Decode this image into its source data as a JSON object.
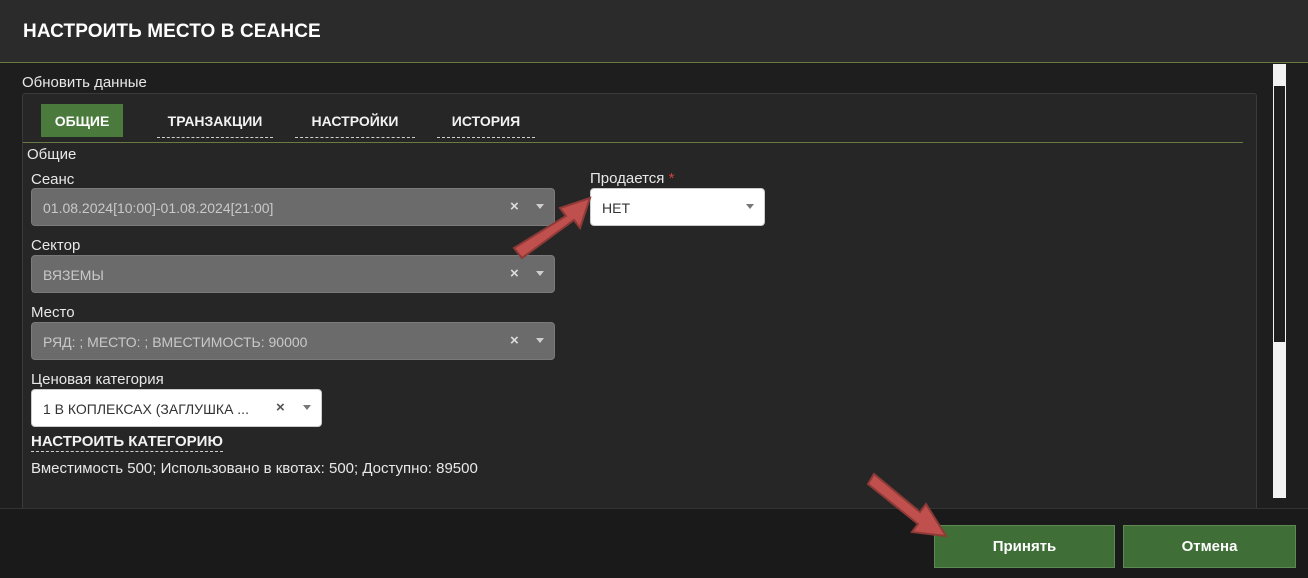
{
  "dialog": {
    "title": "НАСТРОИТЬ МЕСТО В СЕАНСЕ",
    "refresh_label": "Обновить данные"
  },
  "tabs": [
    {
      "label": "ОБЩИЕ",
      "active": true
    },
    {
      "label": "ТРАНЗАКЦИИ",
      "active": false
    },
    {
      "label": "НАСТРОЙКИ",
      "active": false
    },
    {
      "label": "ИСТОРИЯ",
      "active": false
    }
  ],
  "general": {
    "section_title": "Общие",
    "session": {
      "label": "Сеанс",
      "value": "01.08.2024[10:00]-01.08.2024[21:00]"
    },
    "sector": {
      "label": "Сектор",
      "value": "ВЯЗЕМЫ"
    },
    "place": {
      "label": "Место",
      "value": "РЯД: ; МЕСТО: ; ВМЕСТИМОСТЬ: 90000"
    },
    "price_category": {
      "label": "Ценовая категория",
      "value": "1 В КОПЛЕКСАХ (ЗАГЛУШКА ..."
    },
    "configure_category_link": "НАСТРОИТЬ КАТЕГОРИЮ",
    "capacity_info": "Вместимость 500; Использовано в квотах: 500; Доступно: 89500",
    "on_sale": {
      "label": "Продается",
      "required_mark": "*",
      "value": "НЕТ"
    }
  },
  "footer": {
    "accept_label": "Принять",
    "cancel_label": "Отмена"
  },
  "icons": {
    "clear": "×",
    "dropdown": "chevron-down-icon"
  },
  "colors": {
    "accent_green": "#3f6e37",
    "annotation_arrow": "#c0504d"
  }
}
